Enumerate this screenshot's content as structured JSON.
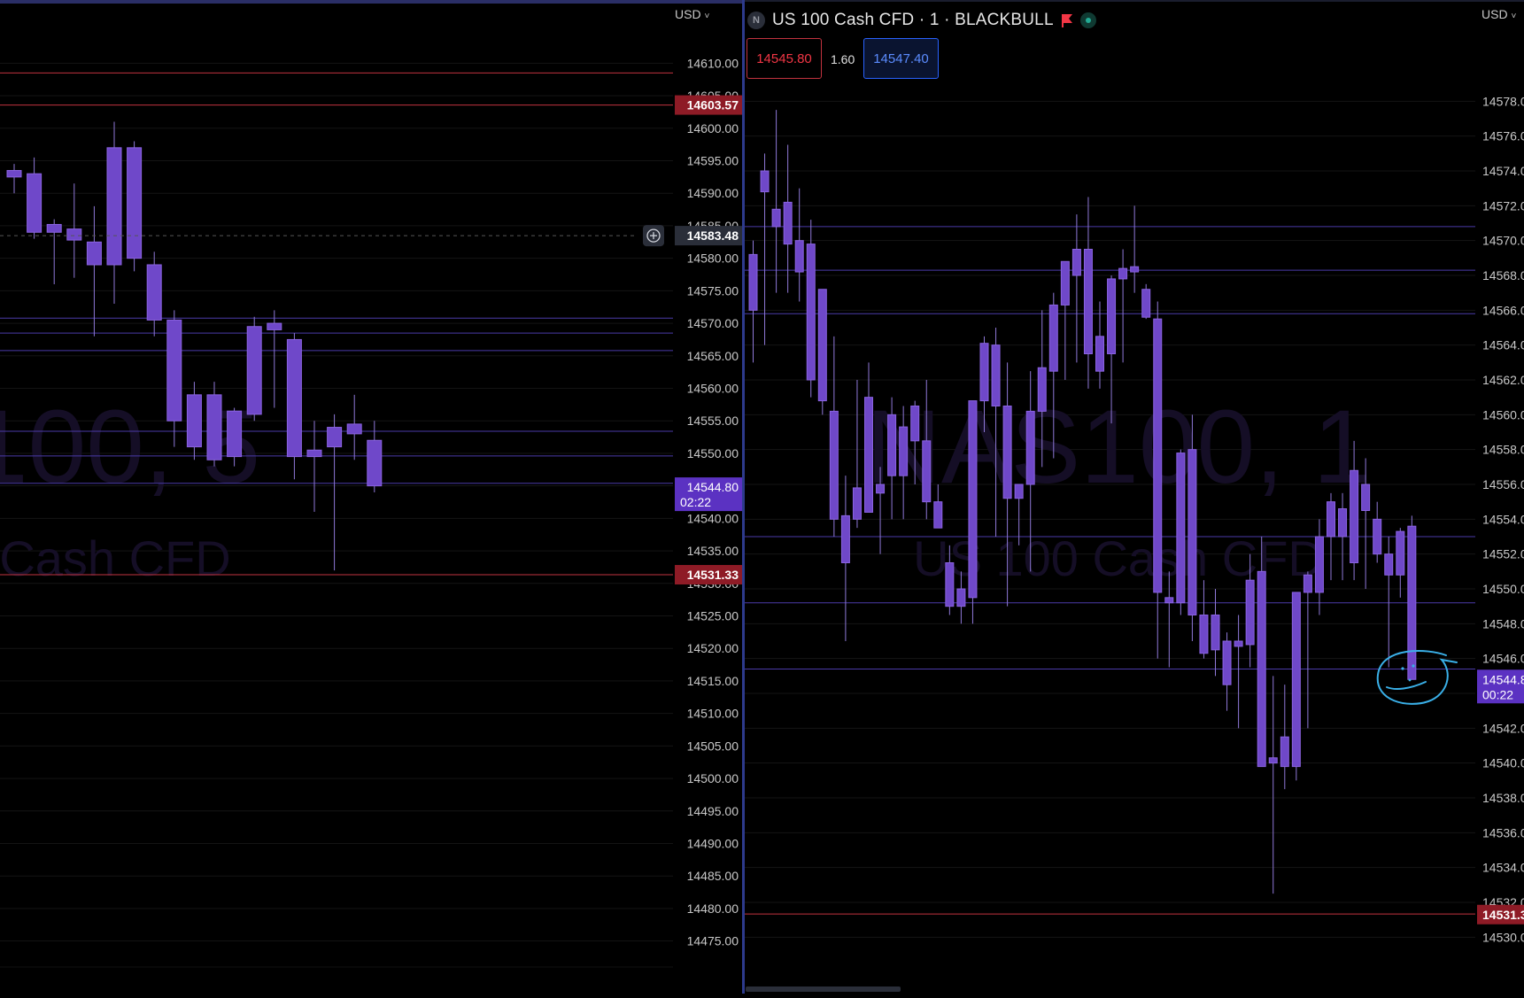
{
  "header": {
    "symbol_badge": "N",
    "symbol_title": "US 100 Cash CFD · 1 · BLACKBULL",
    "sell_price": "14545.80",
    "spread": "1.60",
    "buy_price": "14547.40",
    "currency_left": "USD",
    "currency_right": "USD"
  },
  "colors": {
    "background": "#000000",
    "candle": "#6f48c9",
    "candle_border": "#8a63e0",
    "wick": "#8f79d8",
    "horizontal_line": "#4a3aa8",
    "support_line": "#c2333f",
    "label_red": "#8e1b26",
    "label_purple": "#5b32c2",
    "axis_text": "#c8c8c8",
    "watermark": "#150e26",
    "drawing": "#3ab0e8"
  },
  "chart_data": [
    {
      "type": "candlestick",
      "name": "left-panel",
      "ylim": [
        14471,
        14614
      ],
      "y_ticks": [
        14610.0,
        14605.0,
        14600.0,
        14595.0,
        14590.0,
        14585.0,
        14580.0,
        14575.0,
        14570.0,
        14565.0,
        14560.0,
        14555.0,
        14550.0,
        14545.0,
        14540.0,
        14535.0,
        14530.0,
        14525.0,
        14520.0,
        14515.0,
        14510.0,
        14505.0,
        14500.0,
        14495.0,
        14490.0,
        14485.0,
        14480.0,
        14475.0
      ],
      "watermark_main": "100, 5",
      "watermark_sub": "Cash CFD",
      "candles": [
        {
          "o": 14592.5,
          "h": 14594.5,
          "l": 14590.0,
          "c": 14593.5
        },
        {
          "o": 14593.0,
          "h": 14595.5,
          "l": 14583.0,
          "c": 14584.0
        },
        {
          "o": 14584.0,
          "h": 14586.0,
          "l": 14576.0,
          "c": 14585.2
        },
        {
          "o": 14584.5,
          "h": 14591.5,
          "l": 14577.0,
          "c": 14582.8
        },
        {
          "o": 14582.5,
          "h": 14588.0,
          "l": 14568.0,
          "c": 14579.0
        },
        {
          "o": 14579.0,
          "h": 14601.0,
          "l": 14573.0,
          "c": 14597.0
        },
        {
          "o": 14597.0,
          "h": 14598.0,
          "l": 14578.0,
          "c": 14580.0
        },
        {
          "o": 14579.0,
          "h": 14581.0,
          "l": 14568.0,
          "c": 14570.5
        },
        {
          "o": 14570.5,
          "h": 14572.0,
          "l": 14551.0,
          "c": 14555.0
        },
        {
          "o": 14551.0,
          "h": 14561.0,
          "l": 14549.0,
          "c": 14559.0
        },
        {
          "o": 14559.0,
          "h": 14561.0,
          "l": 14548.0,
          "c": 14549.0
        },
        {
          "o": 14549.5,
          "h": 14557.0,
          "l": 14548.0,
          "c": 14556.5
        },
        {
          "o": 14556.0,
          "h": 14571.0,
          "l": 14555.0,
          "c": 14569.5
        },
        {
          "o": 14569.0,
          "h": 14572.0,
          "l": 14557.0,
          "c": 14570.0
        },
        {
          "o": 14567.5,
          "h": 14568.5,
          "l": 14546.0,
          "c": 14549.5
        },
        {
          "o": 14549.5,
          "h": 14555.0,
          "l": 14541.0,
          "c": 14550.5
        },
        {
          "o": 14554.0,
          "h": 14556.0,
          "l": 14532.0,
          "c": 14551.0
        },
        {
          "o": 14553.0,
          "h": 14559.0,
          "l": 14549.0,
          "c": 14554.5
        },
        {
          "o": 14552.0,
          "h": 14555.0,
          "l": 14544.0,
          "c": 14545.0
        }
      ],
      "h_lines": [
        14570.8,
        14568.5,
        14565.8,
        14553.4,
        14549.6,
        14545.4
      ],
      "support_lines": [
        14608.5,
        14603.57,
        14531.33
      ],
      "crosshair_price": "14583.48",
      "last_price_label": "14544.80",
      "last_price_countdown": "02:22",
      "red_labels": [
        "14603.57",
        "14531.33"
      ]
    },
    {
      "type": "candlestick",
      "name": "right-panel",
      "ylim": [
        14529.0,
        14580.0
      ],
      "y_ticks": [
        14578.0,
        14576.0,
        14574.0,
        14572.0,
        14570.0,
        14568.0,
        14566.0,
        14564.0,
        14562.0,
        14560.0,
        14558.0,
        14556.0,
        14554.0,
        14552.0,
        14550.0,
        14548.0,
        14546.0,
        14544.0,
        14542.0,
        14540.0,
        14538.0,
        14536.0,
        14534.0,
        14532.0,
        14530.0
      ],
      "watermark_main": "NAS100, 1",
      "watermark_sub": "US 100 Cash CFD",
      "candles": [
        {
          "o": 14566.0,
          "h": 14570.0,
          "l": 14563.0,
          "c": 14569.2
        },
        {
          "o": 14574.0,
          "h": 14575.0,
          "l": 14564.0,
          "c": 14572.8
        },
        {
          "o": 14571.8,
          "h": 14577.5,
          "l": 14567.0,
          "c": 14570.8
        },
        {
          "o": 14572.2,
          "h": 14575.5,
          "l": 14567.0,
          "c": 14569.8
        },
        {
          "o": 14570.0,
          "h": 14573.0,
          "l": 14566.5,
          "c": 14568.2
        },
        {
          "o": 14569.8,
          "h": 14571.2,
          "l": 14561.0,
          "c": 14562.0
        },
        {
          "o": 14560.8,
          "h": 14566.0,
          "l": 14560.0,
          "c": 14567.2
        },
        {
          "o": 14560.2,
          "h": 14564.5,
          "l": 14553.0,
          "c": 14554.0
        },
        {
          "o": 14554.2,
          "h": 14556.5,
          "l": 14547.0,
          "c": 14551.5
        },
        {
          "o": 14555.8,
          "h": 14562.0,
          "l": 14553.5,
          "c": 14554.0
        },
        {
          "o": 14561.0,
          "h": 14563.0,
          "l": 14555.0,
          "c": 14554.4
        },
        {
          "o": 14555.5,
          "h": 14557.0,
          "l": 14552.0,
          "c": 14556.0
        },
        {
          "o": 14560.0,
          "h": 14561.0,
          "l": 14554.0,
          "c": 14556.5
        },
        {
          "o": 14556.5,
          "h": 14560.5,
          "l": 14554.0,
          "c": 14559.3
        },
        {
          "o": 14560.5,
          "h": 14560.8,
          "l": 14556.0,
          "c": 14558.5
        },
        {
          "o": 14558.5,
          "h": 14562.0,
          "l": 14554.0,
          "c": 14555.0
        },
        {
          "o": 14555.0,
          "h": 14556.0,
          "l": 14553.5,
          "c": 14553.5
        },
        {
          "o": 14551.5,
          "h": 14552.5,
          "l": 14548.5,
          "c": 14549.0
        },
        {
          "o": 14549.0,
          "h": 14551.0,
          "l": 14548.0,
          "c": 14550.0
        },
        {
          "o": 14549.5,
          "h": 14556.0,
          "l": 14548.0,
          "c": 14560.8
        },
        {
          "o": 14560.8,
          "h": 14564.5,
          "l": 14559.0,
          "c": 14564.1
        },
        {
          "o": 14564.0,
          "h": 14565.0,
          "l": 14553.0,
          "c": 14560.5
        },
        {
          "o": 14560.5,
          "h": 14563.0,
          "l": 14549.0,
          "c": 14555.2
        },
        {
          "o": 14555.2,
          "h": 14555.8,
          "l": 14552.5,
          "c": 14556.0
        },
        {
          "o": 14556.0,
          "h": 14562.5,
          "l": 14551.0,
          "c": 14560.2
        },
        {
          "o": 14560.2,
          "h": 14566.0,
          "l": 14557.0,
          "c": 14562.7
        },
        {
          "o": 14562.5,
          "h": 14567.0,
          "l": 14557.5,
          "c": 14566.3
        },
        {
          "o": 14566.3,
          "h": 14568.0,
          "l": 14562.0,
          "c": 14568.8
        },
        {
          "o": 14568.0,
          "h": 14571.5,
          "l": 14563.0,
          "c": 14569.5
        },
        {
          "o": 14569.5,
          "h": 14572.5,
          "l": 14561.5,
          "c": 14563.5
        },
        {
          "o": 14562.5,
          "h": 14566.5,
          "l": 14561.5,
          "c": 14564.5
        },
        {
          "o": 14563.5,
          "h": 14568.0,
          "l": 14559.5,
          "c": 14567.8
        },
        {
          "o": 14567.8,
          "h": 14569.5,
          "l": 14563.0,
          "c": 14568.4
        },
        {
          "o": 14568.2,
          "h": 14572.0,
          "l": 14567.0,
          "c": 14568.5
        },
        {
          "o": 14567.2,
          "h": 14567.5,
          "l": 14565.5,
          "c": 14565.6
        },
        {
          "o": 14565.5,
          "h": 14566.5,
          "l": 14546.0,
          "c": 14549.8
        },
        {
          "o": 14549.5,
          "h": 14551.0,
          "l": 14545.5,
          "c": 14549.2
        },
        {
          "o": 14549.2,
          "h": 14558.0,
          "l": 14548.5,
          "c": 14557.8
        },
        {
          "o": 14558.0,
          "h": 14560.0,
          "l": 14547.0,
          "c": 14548.5
        },
        {
          "o": 14548.5,
          "h": 14550.5,
          "l": 14546.0,
          "c": 14546.3
        },
        {
          "o": 14546.5,
          "h": 14550.0,
          "l": 14545.0,
          "c": 14548.5
        },
        {
          "o": 14547.0,
          "h": 14547.5,
          "l": 14543.0,
          "c": 14544.5
        },
        {
          "o": 14546.7,
          "h": 14548.5,
          "l": 14542.0,
          "c": 14547.0
        },
        {
          "o": 14546.8,
          "h": 14552.0,
          "l": 14545.5,
          "c": 14550.5
        },
        {
          "o": 14551.0,
          "h": 14553.0,
          "l": 14540.0,
          "c": 14539.8
        },
        {
          "o": 14540.3,
          "h": 14545.0,
          "l": 14532.5,
          "c": 14540.0
        },
        {
          "o": 14539.8,
          "h": 14544.5,
          "l": 14538.5,
          "c": 14541.5
        },
        {
          "o": 14539.8,
          "h": 14543.0,
          "l": 14539.0,
          "c": 14549.8
        },
        {
          "o": 14549.8,
          "h": 14551.0,
          "l": 14542.0,
          "c": 14550.8
        },
        {
          "o": 14549.8,
          "h": 14554.0,
          "l": 14548.5,
          "c": 14553.0
        },
        {
          "o": 14553.0,
          "h": 14555.5,
          "l": 14550.5,
          "c": 14555.0
        },
        {
          "o": 14553.0,
          "h": 14555.5,
          "l": 14550.5,
          "c": 14554.6
        },
        {
          "o": 14551.5,
          "h": 14558.5,
          "l": 14550.5,
          "c": 14556.8
        },
        {
          "o": 14556.0,
          "h": 14557.5,
          "l": 14550.0,
          "c": 14554.5
        },
        {
          "o": 14554.0,
          "h": 14555.0,
          "l": 14551.5,
          "c": 14552.0
        },
        {
          "o": 14552.0,
          "h": 14553.0,
          "l": 14545.5,
          "c": 14550.8
        },
        {
          "o": 14550.8,
          "h": 14553.5,
          "l": 14549.5,
          "c": 14553.3
        },
        {
          "o": 14553.6,
          "h": 14554.2,
          "l": 14544.8,
          "c": 14544.8
        }
      ],
      "h_lines": [
        14570.8,
        14568.3,
        14565.8,
        14553.0,
        14549.2,
        14545.4
      ],
      "support_lines": [
        14531.33
      ],
      "last_price_label": "14544.8",
      "last_price_countdown": "00:22",
      "red_labels": [
        "14531.3"
      ]
    }
  ]
}
